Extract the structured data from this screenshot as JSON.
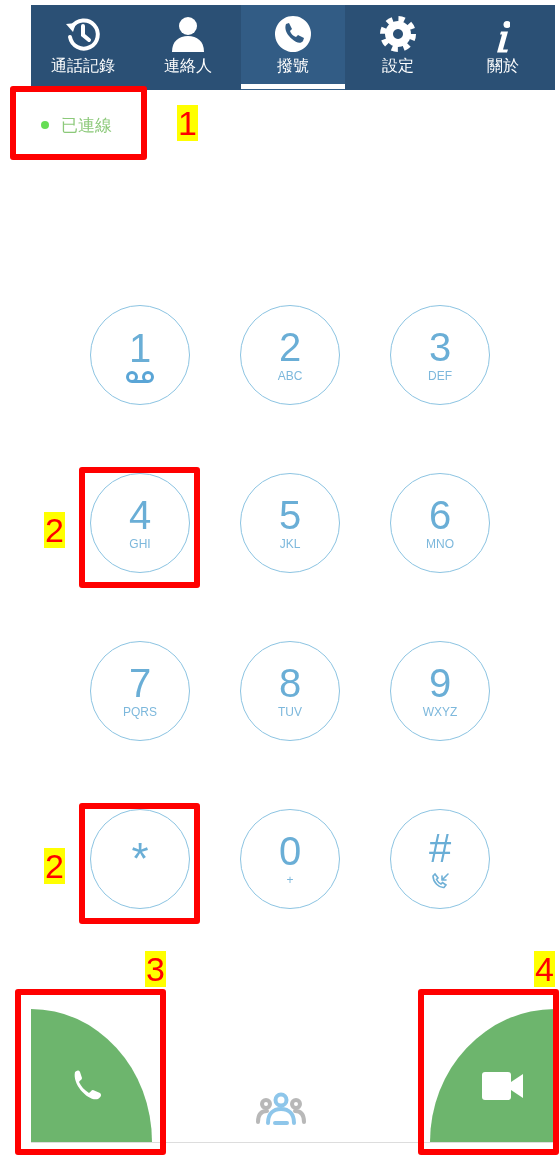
{
  "tabs": [
    {
      "label": "通話記錄",
      "kind": "history",
      "selected": false
    },
    {
      "label": "連絡人",
      "kind": "contacts",
      "selected": false
    },
    {
      "label": "撥號",
      "kind": "dial",
      "selected": true
    },
    {
      "label": "設定",
      "kind": "settings",
      "selected": false
    },
    {
      "label": "關於",
      "kind": "about",
      "selected": false
    }
  ],
  "status": {
    "text": "已連線",
    "connected": true
  },
  "keypad": [
    {
      "digit": "1",
      "kind": "voicemail"
    },
    {
      "digit": "2",
      "letters": "ABC",
      "kind": "letters"
    },
    {
      "digit": "3",
      "letters": "DEF",
      "kind": "letters"
    },
    {
      "digit": "4",
      "letters": "GHI",
      "kind": "letters"
    },
    {
      "digit": "5",
      "letters": "JKL",
      "kind": "letters"
    },
    {
      "digit": "6",
      "letters": "MNO",
      "kind": "letters"
    },
    {
      "digit": "7",
      "letters": "PQRS",
      "kind": "letters"
    },
    {
      "digit": "8",
      "letters": "TUV",
      "kind": "letters"
    },
    {
      "digit": "9",
      "letters": "WXYZ",
      "kind": "letters"
    },
    {
      "digit": "*",
      "kind": "plain"
    },
    {
      "digit": "0",
      "letters": "+",
      "kind": "letters"
    },
    {
      "digit": "#",
      "kind": "callback"
    }
  ],
  "call_buttons": [
    {
      "kind": "voice"
    },
    {
      "kind": "video"
    }
  ],
  "annotations": [
    {
      "label": "1"
    },
    {
      "label": "2"
    },
    {
      "label": "2"
    },
    {
      "label": "3"
    },
    {
      "label": "4"
    }
  ]
}
